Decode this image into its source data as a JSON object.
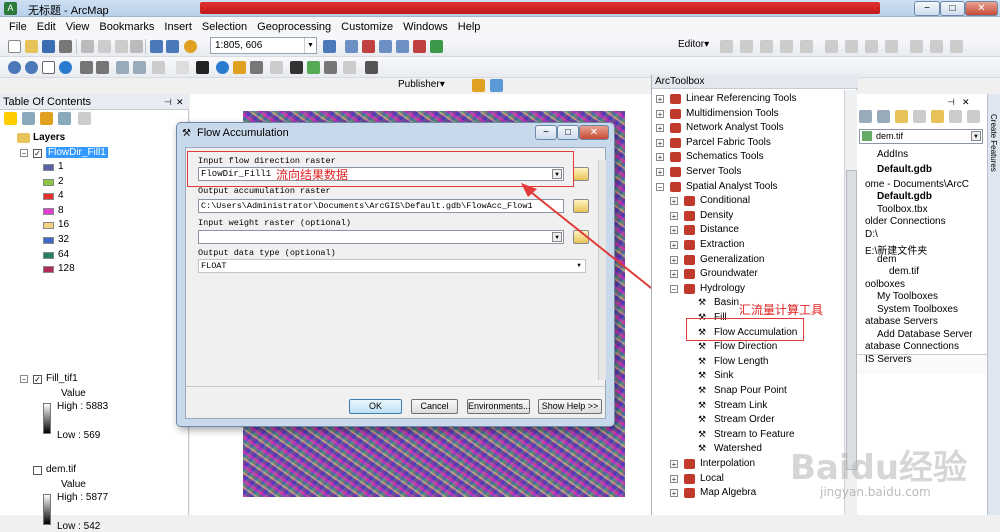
{
  "window": {
    "title": "无标题 - ArcMap",
    "min": "−",
    "max": "□",
    "close": "✕"
  },
  "menu": [
    "File",
    "Edit",
    "View",
    "Bookmarks",
    "Insert",
    "Selection",
    "Geoprocessing",
    "Customize",
    "Windows",
    "Help"
  ],
  "toolbar": {
    "scale": "1:805, 606",
    "editor": "Editor▾",
    "publisher": "Publisher▾"
  },
  "toc": {
    "title": "Table Of Contents",
    "root": "Layers",
    "layer1": {
      "name": "FlowDir_Fill1",
      "classes": [
        {
          "label": "1",
          "color": "#5b5fa8"
        },
        {
          "label": "2",
          "color": "#8ac63f"
        },
        {
          "label": "4",
          "color": "#e8312c"
        },
        {
          "label": "8",
          "color": "#e23fd2"
        },
        {
          "label": "16",
          "color": "#f2d183"
        },
        {
          "label": "32",
          "color": "#3f69c9"
        },
        {
          "label": "64",
          "color": "#24805f"
        },
        {
          "label": "128",
          "color": "#b02a5c"
        }
      ]
    },
    "layer2": {
      "name": "Fill_tif1",
      "value": "Value",
      "high": "High : 5883",
      "low": "Low : 569"
    },
    "layer3": {
      "name": "dem.tif",
      "value": "Value",
      "high": "High : 5877",
      "low": "Low : 542"
    }
  },
  "dialog": {
    "title": "Flow Accumulation",
    "input_label": "Input flow direction raster",
    "input_value": "FlowDir_Fill1",
    "input_note": "流向结果数据",
    "output_label": "Output accumulation raster",
    "output_value": "C:\\Users\\Administrator\\Documents\\ArcGIS\\Default.gdb\\FlowAcc_Flow1",
    "weight_label": "Input weight raster (optional)",
    "weight_value": "",
    "type_label": "Output data type (optional)",
    "type_value": "FLOAT",
    "ok": "OK",
    "cancel": "Cancel",
    "env": "Environments...",
    "help": "Show Help >>"
  },
  "toolbox": {
    "title": "ArcToolbox",
    "top_items": [
      "Linear Referencing Tools",
      "Multidimension Tools",
      "Network Analyst Tools",
      "Parcel Fabric Tools",
      "Schematics Tools",
      "Server Tools",
      "Spatial Analyst Tools"
    ],
    "spatial": [
      "Conditional",
      "Density",
      "Distance",
      "Extraction",
      "Generalization",
      "Groundwater",
      "Hydrology"
    ],
    "hydrology": [
      "Basin",
      "Fill",
      "Flow Accumulation",
      "Flow Direction",
      "Flow Length",
      "Sink",
      "Snap Pour Point",
      "Stream Link",
      "Stream Order",
      "Stream to Feature",
      "Watershed"
    ],
    "after": [
      "Interpolation",
      "Local",
      "Map Algebra"
    ],
    "note": "汇流量计算工具"
  },
  "catalog": {
    "location": "dem.tif",
    "items": [
      "AddIns",
      "Default.gdb",
      "ome - Documents\\ArcC",
      "Default.gdb",
      "Toolbox.tbx",
      "older Connections",
      "D:\\",
      "E:\\新建文件夹",
      "dem",
      "dem.tif",
      "oolboxes",
      "My Toolboxes",
      "System Toolboxes",
      "atabase Servers",
      "Add Database Server",
      "atabase Connections",
      "IS Servers"
    ],
    "side_tab": "Create Features"
  },
  "watermark": {
    "main": "Baidu经验",
    "sub": "jingyan.baidu.com"
  }
}
